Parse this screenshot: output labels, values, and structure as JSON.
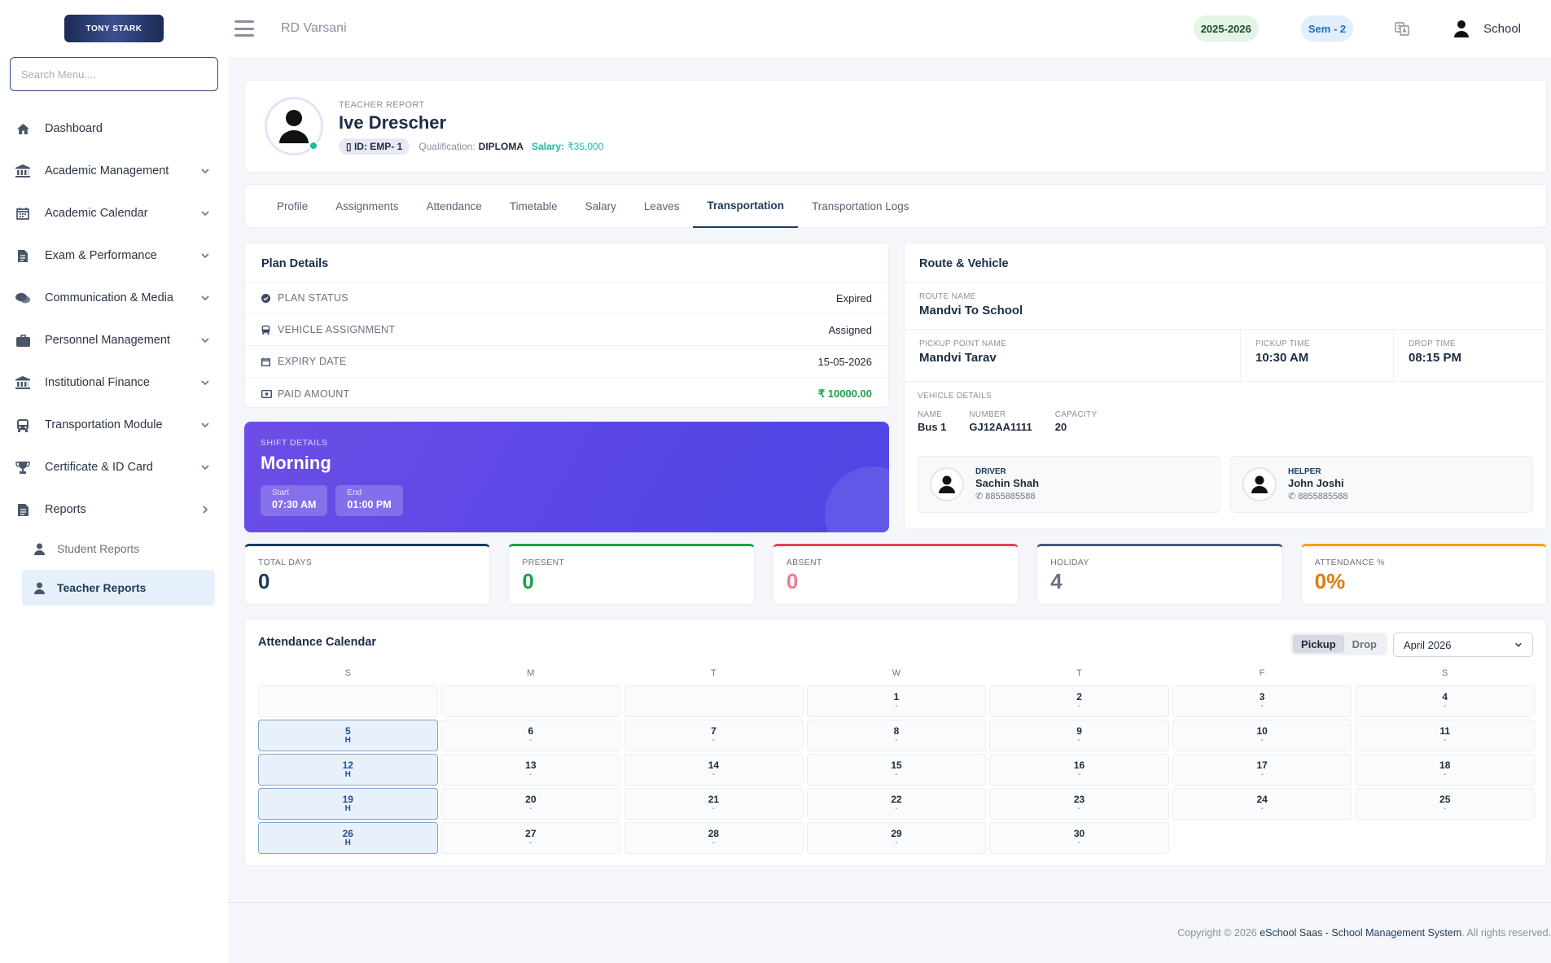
{
  "sidebar": {
    "logo_text": "TONY STARK",
    "search_placeholder": "Search Menu....",
    "items": [
      {
        "label": "Dashboard",
        "icon": "home-icon"
      },
      {
        "label": "Academic Management",
        "icon": "bank-icon"
      },
      {
        "label": "Academic Calendar",
        "icon": "calendar-icon"
      },
      {
        "label": "Exam & Performance",
        "icon": "exam-icon"
      },
      {
        "label": "Communication & Media",
        "icon": "chat-icon"
      },
      {
        "label": "Personnel Management",
        "icon": "briefcase-icon"
      },
      {
        "label": "Institutional Finance",
        "icon": "bank-icon"
      },
      {
        "label": "Transportation Module",
        "icon": "bus-icon"
      },
      {
        "label": "Certificate & ID Card",
        "icon": "trophy-icon"
      },
      {
        "label": "Reports",
        "icon": "report-icon"
      }
    ],
    "sub_items": [
      {
        "label": "Student Reports"
      },
      {
        "label": "Teacher Reports"
      }
    ]
  },
  "topbar": {
    "school_name": "RD Varsani",
    "year": "2025-2026",
    "semester": "Sem - 2",
    "user": "School"
  },
  "profile": {
    "report_label": "TEACHER REPORT",
    "name": "Ive Drescher",
    "id": "ID: EMP- 1",
    "qualification_label": "Qualification:",
    "qualification": "DIPLOMA",
    "salary_label": "Salary:",
    "salary": "₹35,000"
  },
  "tabs": [
    "Profile",
    "Assignments",
    "Attendance",
    "Timetable",
    "Salary",
    "Leaves",
    "Transportation",
    "Transportation Logs"
  ],
  "plan": {
    "title": "Plan Details",
    "rows": [
      {
        "label": "PLAN STATUS",
        "value": "Expired"
      },
      {
        "label": "VEHICLE ASSIGNMENT",
        "value": "Assigned"
      },
      {
        "label": "EXPIRY DATE",
        "value": "15-05-2026"
      },
      {
        "label": "PAID AMOUNT",
        "value": "₹ 10000.00"
      }
    ]
  },
  "shift": {
    "label": "SHIFT DETAILS",
    "name": "Morning",
    "start_label": "Start",
    "start": "07:30 AM",
    "end_label": "End",
    "end": "01:00 PM"
  },
  "route": {
    "title": "Route & Vehicle",
    "route_label": "ROUTE NAME",
    "route_name": "Mandvi To School",
    "pickup_point_label": "PICKUP POINT NAME",
    "pickup_point": "Mandvi Tarav",
    "pickup_time_label": "PICKUP TIME",
    "pickup_time": "10:30 AM",
    "drop_time_label": "DROP TIME",
    "drop_time": "08:15 PM",
    "vehicle_label": "VEHICLE DETAILS",
    "vehicle_name_label": "NAME",
    "vehicle_name": "Bus 1",
    "vehicle_number_label": "NUMBER",
    "vehicle_number": "GJ12AA1111",
    "capacity_label": "CAPACITY",
    "capacity": "20",
    "driver_label": "DRIVER",
    "driver_name": "Sachin Shah",
    "driver_phone": "8855885588",
    "helper_label": "HELPER",
    "helper_name": "John Joshi",
    "helper_phone": "8855885588"
  },
  "stats": [
    {
      "label": "TOTAL DAYS",
      "value": "0",
      "color": "#1b3a5c"
    },
    {
      "label": "PRESENT",
      "value": "0",
      "color": "#16a34a"
    },
    {
      "label": "ABSENT",
      "value": "0",
      "color": "#e0455b"
    },
    {
      "label": "HOLIDAY",
      "value": "4",
      "color": "#4a5a78"
    },
    {
      "label": "ATTENDANCE %",
      "value": "0%",
      "color": "#e07b0d"
    }
  ],
  "calendar": {
    "title": "Attendance Calendar",
    "toggle": [
      "Pickup",
      "Drop"
    ],
    "month": "April 2026",
    "weekdays": [
      "S",
      "M",
      "T",
      "W",
      "T",
      "F",
      "S"
    ],
    "days": [
      null,
      null,
      null,
      {
        "d": "1",
        "s": "-"
      },
      {
        "d": "2",
        "s": "-"
      },
      {
        "d": "3",
        "s": "-"
      },
      {
        "d": "4",
        "s": "-"
      },
      {
        "d": "5",
        "s": "H"
      },
      {
        "d": "6",
        "s": "-"
      },
      {
        "d": "7",
        "s": "-"
      },
      {
        "d": "8",
        "s": "-"
      },
      {
        "d": "9",
        "s": "-"
      },
      {
        "d": "10",
        "s": "-"
      },
      {
        "d": "11",
        "s": "-"
      },
      {
        "d": "12",
        "s": "H"
      },
      {
        "d": "13",
        "s": "-"
      },
      {
        "d": "14",
        "s": "-"
      },
      {
        "d": "15",
        "s": "-"
      },
      {
        "d": "16",
        "s": "-"
      },
      {
        "d": "17",
        "s": "-"
      },
      {
        "d": "18",
        "s": "-"
      },
      {
        "d": "19",
        "s": "H"
      },
      {
        "d": "20",
        "s": "-"
      },
      {
        "d": "21",
        "s": "-"
      },
      {
        "d": "22",
        "s": "-"
      },
      {
        "d": "23",
        "s": "-"
      },
      {
        "d": "24",
        "s": "-"
      },
      {
        "d": "25",
        "s": "-"
      },
      {
        "d": "26",
        "s": "H"
      },
      {
        "d": "27",
        "s": "-"
      },
      {
        "d": "28",
        "s": "-"
      },
      {
        "d": "29",
        "s": "-"
      },
      {
        "d": "30",
        "s": "-"
      }
    ]
  },
  "footer": {
    "prefix": "Copyright © 2026 ",
    "link": "eSchool Saas - School Management System",
    "suffix": ". All rights reserved."
  }
}
